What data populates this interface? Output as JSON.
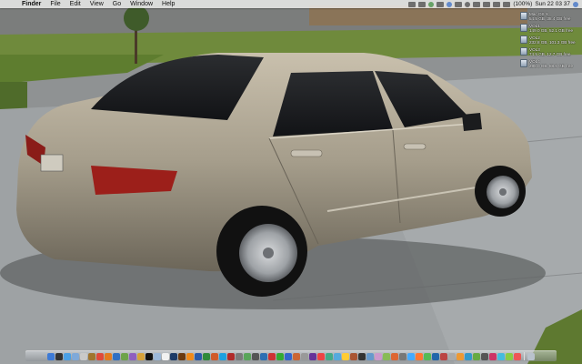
{
  "menubar": {
    "apple_glyph": "",
    "items": [
      "Finder",
      "File",
      "Edit",
      "View",
      "Go",
      "Window",
      "Help"
    ],
    "battery": "(100%)",
    "clock": "Sun 22 03 37"
  },
  "desktop": {
    "wallpaper": "Photo of a silver/gold sedan parked on a concrete driveway",
    "colors": {
      "car_body": "#a8a08f",
      "driveway": "#9da2a5",
      "lawn": "#6b8a3a",
      "sky_road": "#8a8d8e"
    },
    "disks": [
      {
        "name": "Mac OS X",
        "detail": "54.5 GB, 38.4 GB free"
      },
      {
        "name": "VOL1",
        "detail": "149.0 GB, 52.1 GB free"
      },
      {
        "name": "VOL2",
        "detail": "232.8 GB, 101.3 GB free"
      },
      {
        "name": "VOL3",
        "detail": "74.5 GB, 12.7 GB free"
      },
      {
        "name": "VOL4",
        "detail": "298.0 GB, 88.6 GB free"
      }
    ]
  },
  "dock": {
    "icons": [
      {
        "name": "finder-icon",
        "color": "#3d7ad6"
      },
      {
        "name": "dashboard-icon",
        "color": "#333"
      },
      {
        "name": "safari-icon",
        "color": "#4aa0e6"
      },
      {
        "name": "mail-icon",
        "color": "#7fa9d9"
      },
      {
        "name": "ichat-icon",
        "color": "#c9c9c9"
      },
      {
        "name": "address-book-icon",
        "color": "#a0752f"
      },
      {
        "name": "ical-icon",
        "color": "#e04a3a"
      },
      {
        "name": "firefox-icon",
        "color": "#e37b1f"
      },
      {
        "name": "itunes-icon",
        "color": "#2f6fc4"
      },
      {
        "name": "iphoto-icon",
        "color": "#6da34a"
      },
      {
        "name": "imovie-icon",
        "color": "#8f5fbf"
      },
      {
        "name": "garageband-icon",
        "color": "#d7a23a"
      },
      {
        "name": "terminal-icon",
        "color": "#111"
      },
      {
        "name": "preview-icon",
        "color": "#9cb8d9"
      },
      {
        "name": "textedit-icon",
        "color": "#f1f1f1"
      },
      {
        "name": "photoshop-icon",
        "color": "#1d3a66"
      },
      {
        "name": "illustrator-icon",
        "color": "#6b3a10"
      },
      {
        "name": "vlc-icon",
        "color": "#f08a1a"
      },
      {
        "name": "word-icon",
        "color": "#2a5aa8"
      },
      {
        "name": "excel-icon",
        "color": "#2f8a3a"
      },
      {
        "name": "powerpoint-icon",
        "color": "#d05a2a"
      },
      {
        "name": "skype-icon",
        "color": "#1fa0e0"
      },
      {
        "name": "transmission-icon",
        "color": "#b02a2a"
      },
      {
        "name": "system-preferences-icon",
        "color": "#7b7b7b"
      },
      {
        "name": "activity-monitor-icon",
        "color": "#59a55a"
      },
      {
        "name": "calculator-icon",
        "color": "#555"
      },
      {
        "name": "quicktime-icon",
        "color": "#2f6fb3"
      },
      {
        "name": "app-icon-28",
        "color": "#c33"
      },
      {
        "name": "app-icon-29",
        "color": "#3a3"
      },
      {
        "name": "app-icon-30",
        "color": "#36c"
      },
      {
        "name": "app-icon-31",
        "color": "#c63"
      },
      {
        "name": "app-icon-32",
        "color": "#999"
      },
      {
        "name": "app-icon-33",
        "color": "#639"
      },
      {
        "name": "app-icon-34",
        "color": "#e44"
      },
      {
        "name": "app-icon-35",
        "color": "#4a8"
      },
      {
        "name": "app-icon-36",
        "color": "#5ad"
      },
      {
        "name": "app-icon-37",
        "color": "#fc3"
      },
      {
        "name": "app-icon-38",
        "color": "#a53"
      },
      {
        "name": "app-icon-39",
        "color": "#333"
      },
      {
        "name": "app-icon-40",
        "color": "#69c"
      },
      {
        "name": "app-icon-41",
        "color": "#c9c"
      },
      {
        "name": "app-icon-42",
        "color": "#8b5"
      },
      {
        "name": "app-icon-43",
        "color": "#d63"
      },
      {
        "name": "app-icon-44",
        "color": "#777"
      },
      {
        "name": "app-icon-45",
        "color": "#4af"
      },
      {
        "name": "app-icon-46",
        "color": "#f73"
      },
      {
        "name": "app-icon-47",
        "color": "#5b5"
      },
      {
        "name": "app-icon-48",
        "color": "#26a"
      },
      {
        "name": "app-icon-49",
        "color": "#b44"
      },
      {
        "name": "app-icon-50",
        "color": "#aaa"
      },
      {
        "name": "app-icon-51",
        "color": "#e93"
      },
      {
        "name": "app-icon-52",
        "color": "#39c"
      },
      {
        "name": "app-icon-53",
        "color": "#6a4"
      },
      {
        "name": "app-icon-54",
        "color": "#555"
      },
      {
        "name": "app-icon-55",
        "color": "#c36"
      },
      {
        "name": "app-icon-56",
        "color": "#4bd"
      },
      {
        "name": "app-icon-57",
        "color": "#8c4"
      },
      {
        "name": "app-icon-58",
        "color": "#e55"
      }
    ],
    "trash": {
      "name": "trash-icon",
      "color": "#b9c2cc"
    }
  }
}
